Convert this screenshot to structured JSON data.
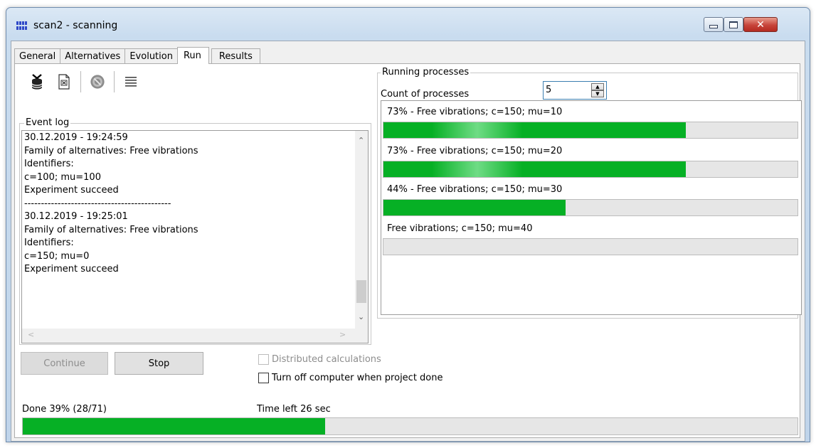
{
  "window": {
    "title": "scan2 - scanning",
    "close_glyph": "✕"
  },
  "tabs": [
    {
      "label": "General"
    },
    {
      "label": "Alternatives"
    },
    {
      "label": "Evolution"
    },
    {
      "label": "Run",
      "active": true
    },
    {
      "label": "Results"
    }
  ],
  "toolbar": {
    "icons": [
      "database-delete-icon",
      "clear-log-icon",
      "stop-disc-icon",
      "list-icon"
    ]
  },
  "event_log": {
    "legend": "Event log",
    "entries": [
      "30.12.2019 - 19:24:59\nFamily of alternatives: Free vibrations\nIdentifiers:\nc=100; mu=100\nExperiment succeed\n--------------------------------------------\n30.12.2019 - 19:25:01\nFamily of alternatives: Free vibrations\nIdentifiers:\nc=150; mu=0\nExperiment succeed"
    ]
  },
  "running_processes": {
    "legend": "Running processes",
    "count_label": "Count of processes",
    "count_value": "5",
    "processes": [
      {
        "label": "73% - Free vibrations; c=150; mu=10",
        "progress": 0.73
      },
      {
        "label": "73% - Free vibrations; c=150; mu=20",
        "progress": 0.73
      },
      {
        "label": "44% - Free vibrations; c=150; mu=30",
        "progress": 0.44
      },
      {
        "label": "Free vibrations; c=150; mu=40",
        "progress": 0.0
      }
    ]
  },
  "buttons": {
    "continue_label": "Continue",
    "stop_label": "Stop"
  },
  "options": {
    "distributed_label": "Distributed calculations",
    "turn_off_label": "Turn off computer when project done"
  },
  "status": {
    "done_text": "Done 39% (28/71)",
    "time_left_text": "Time left 26 sec",
    "overall_progress": 0.39
  },
  "colors": {
    "progress_fill": "#06b025",
    "accent": "#3c7fb1"
  }
}
